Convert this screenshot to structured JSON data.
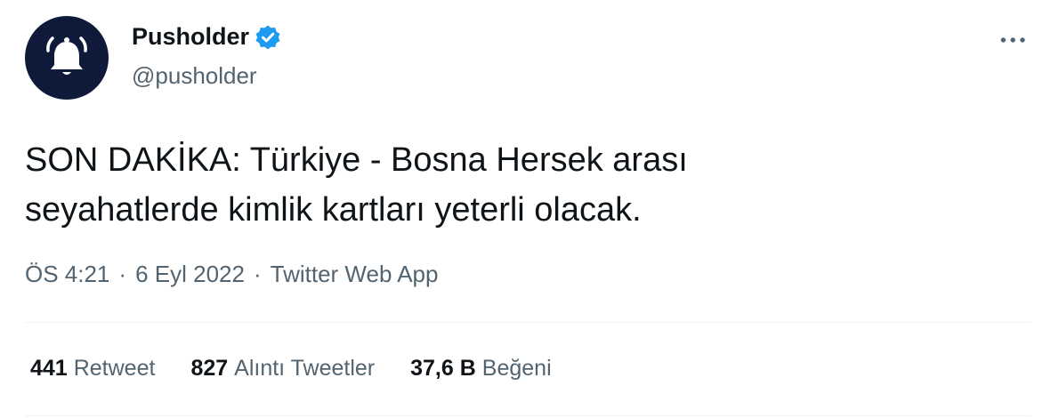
{
  "account": {
    "display_name": "Pusholder",
    "handle": "@pusholder",
    "verified": true,
    "avatar_icon": "bell-icon",
    "avatar_bg": "#0f1a3a"
  },
  "tweet": {
    "line1": "SON DAKİKA: Türkiye - Bosna Hersek arası",
    "line2": "seyahatlerde kimlik kartları yeterli olacak."
  },
  "meta": {
    "time": "ÖS 4:21",
    "separator": "·",
    "date": "6 Eyl 2022",
    "source": "Twitter Web App"
  },
  "stats": [
    {
      "count": "441",
      "label": "Retweet"
    },
    {
      "count": "827",
      "label": "Alıntı Tweetler"
    },
    {
      "count": "37,6 B",
      "label": "Beğeni"
    }
  ],
  "colors": {
    "verified": "#1d9bf0",
    "secondary_text": "#536471"
  }
}
